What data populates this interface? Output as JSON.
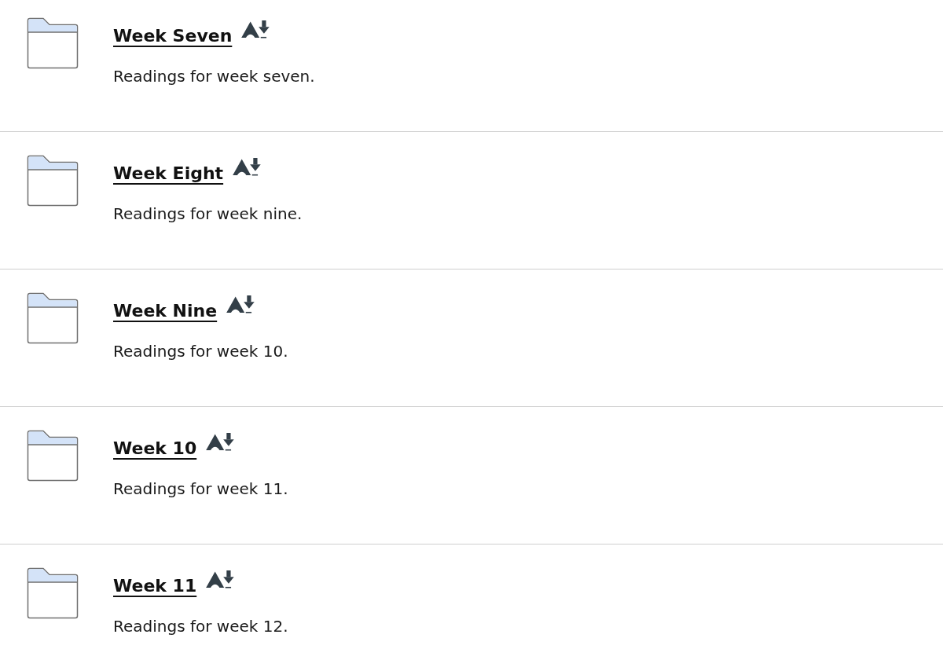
{
  "items": [
    {
      "title": "Week Seven",
      "description": "Readings for week seven."
    },
    {
      "title": "Week Eight",
      "description": "Readings for week nine."
    },
    {
      "title": "Week Nine",
      "description": "Readings for week 10."
    },
    {
      "title": "Week 10",
      "description": "Readings for week 11."
    },
    {
      "title": "Week 11",
      "description": "Readings for week 12."
    }
  ]
}
